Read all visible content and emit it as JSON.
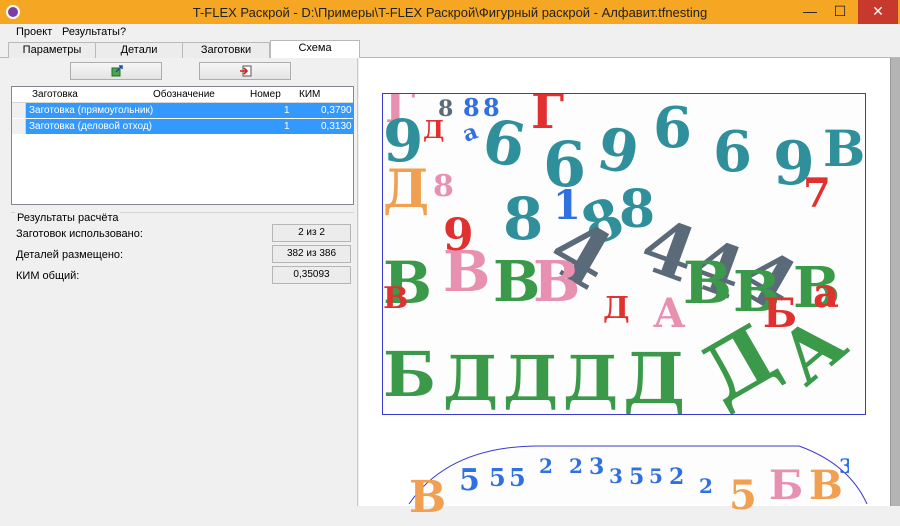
{
  "window": {
    "title": "T-FLEX Раскрой - D:\\Примеры\\T-FLEX Раскрой\\Фигурный раскрой - Алфавит.tfnesting",
    "minimize": "—",
    "maximize": "☐",
    "close": "✕"
  },
  "menu": [
    "Проект",
    "Результаты",
    "?"
  ],
  "tabs": [
    "Параметры",
    "Детали",
    "Заготовки",
    "Схема"
  ],
  "grid": {
    "columns": [
      "Заготовка",
      "Обозначение",
      "Номер",
      "КИМ"
    ],
    "rows": [
      {
        "name": "Заготовка (прямоугольник)",
        "designation": "",
        "number": "1",
        "kim": "0,3790"
      },
      {
        "name": "Заготовка (деловой отход)",
        "designation": "",
        "number": "1",
        "kim": "0,3130"
      }
    ]
  },
  "results": {
    "title": "Результаты расчёта",
    "labels": [
      "Заготовок использовано:",
      "Деталей размещено:",
      "КИМ общий:"
    ],
    "values": [
      "2 из 2",
      "382 из 386",
      "0,35093"
    ]
  },
  "scheme": {
    "sheet1_glyphs": [
      "Г",
      "8",
      "8",
      "8",
      "Г",
      "9",
      "Д",
      "а",
      "6",
      "6",
      "9",
      "6",
      "6",
      "9",
      "В",
      "Д",
      "8",
      "8",
      "1",
      "8",
      "8",
      "4",
      "В",
      "В",
      "В",
      "В",
      "4",
      "4",
      "4",
      "В",
      "В",
      "В",
      "В",
      "Б",
      "Д",
      "Д",
      "Д",
      "Д",
      "Д",
      "А",
      "А",
      "Б",
      "а",
      "Д",
      "7",
      "9"
    ],
    "sheet2_glyphs": [
      "В",
      "5",
      "5",
      "5",
      "2",
      "2",
      "3",
      "3",
      "5",
      "5",
      "2",
      "2",
      "5",
      "Б",
      "В",
      "3"
    ],
    "colors": {
      "green": "#3a9a4a",
      "teal": "#2f8f9a",
      "orange": "#f0a050",
      "pink": "#e890b0",
      "red": "#e03030",
      "blue": "#3070e0",
      "darkgray": "#5a6a78"
    }
  }
}
